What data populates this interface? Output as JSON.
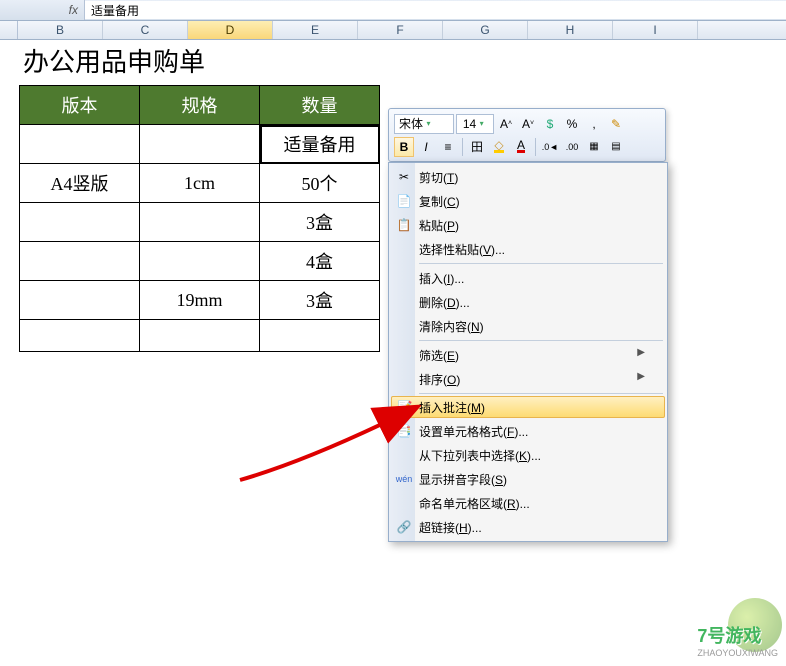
{
  "formula_bar": {
    "fx": "fx",
    "value": "适量备用"
  },
  "columns": [
    "B",
    "C",
    "D",
    "E",
    "F",
    "G",
    "H",
    "I"
  ],
  "selected_col": "D",
  "sheet": {
    "title": "办公用品申购单",
    "headers": [
      "版本",
      "规格",
      "数量"
    ],
    "rows": [
      [
        "",
        "",
        "适量备用"
      ],
      [
        "A4竖版",
        "1cm",
        "50个"
      ],
      [
        "",
        "",
        "3盒"
      ],
      [
        "",
        "",
        "4盒"
      ],
      [
        "",
        "19mm",
        "3盒"
      ],
      [
        "",
        "",
        ""
      ]
    ]
  },
  "mini_toolbar": {
    "font": "宋体",
    "size": "14",
    "buttons_row1": [
      "A˄",
      "A˅",
      "钱",
      "%",
      "，",
      "paint"
    ],
    "bold": "B",
    "italic": "I",
    "align": "≡",
    "border": "田",
    "fill": "◆",
    "fontcolor": "A",
    "decimals": [
      "◄0",
      ".00",
      "indent1",
      "indent2"
    ]
  },
  "context_menu": {
    "items": [
      {
        "icon": "✂",
        "label": "剪切",
        "key": "T"
      },
      {
        "icon": "📄",
        "label": "复制",
        "key": "C"
      },
      {
        "icon": "📋",
        "label": "粘贴",
        "key": "P"
      },
      {
        "icon": "",
        "label": "选择性粘贴",
        "key": "V",
        "suffix": "..."
      },
      {
        "sep": true
      },
      {
        "icon": "",
        "label": "插入",
        "key": "I",
        "suffix": "..."
      },
      {
        "icon": "",
        "label": "删除",
        "key": "D",
        "suffix": "..."
      },
      {
        "icon": "",
        "label": "清除内容",
        "key": "N"
      },
      {
        "sep": true
      },
      {
        "icon": "",
        "label": "筛选",
        "key": "E",
        "arrow": true
      },
      {
        "icon": "",
        "label": "排序",
        "key": "O",
        "arrow": true
      },
      {
        "sep": true
      },
      {
        "icon": "📝",
        "label": "插入批注",
        "key": "M",
        "hover": true
      },
      {
        "icon": "📑",
        "label": "设置单元格格式",
        "key": "F",
        "suffix": "..."
      },
      {
        "icon": "",
        "label": "从下拉列表中选择",
        "key": "K",
        "suffix": "..."
      },
      {
        "icon": "wén",
        "label": "显示拼音字段",
        "key": "S"
      },
      {
        "icon": "",
        "label": "命名单元格区域",
        "key": "R",
        "suffix": "..."
      },
      {
        "icon": "🔗",
        "label": "超链接",
        "key": "H",
        "suffix": "..."
      }
    ]
  },
  "watermark": {
    "text": "7号游戏",
    "sub": "ZHAOYOUXIWANG"
  }
}
